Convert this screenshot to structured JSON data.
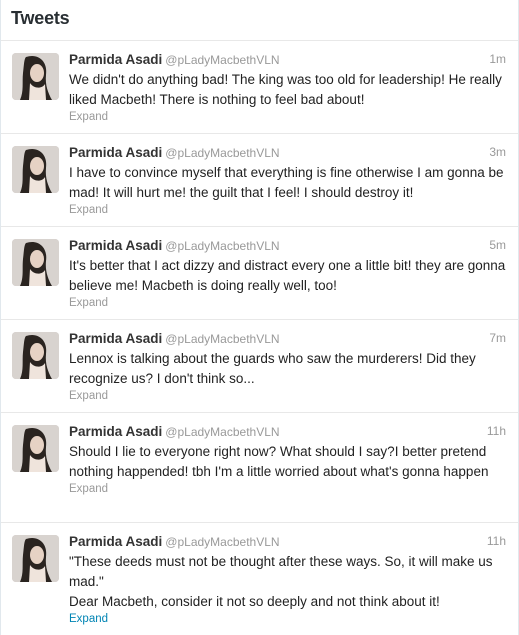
{
  "header": {
    "title": "Tweets"
  },
  "tweets": [
    {
      "name": "Parmida Asadi",
      "handle": "@pLadyMacbethVLN",
      "time": "1m",
      "text": "We didn't do anything bad! The king was too old for leadership! He really liked Macbeth! There is nothing to feel bad about!",
      "expand": "Expand"
    },
    {
      "name": "Parmida Asadi",
      "handle": "@pLadyMacbethVLN",
      "time": "3m",
      "text": "I have to convince myself that everything is fine otherwise I am gonna be mad! It will hurt me! the guilt that I feel! I should destroy it!",
      "expand": "Expand"
    },
    {
      "name": "Parmida Asadi",
      "handle": "@pLadyMacbethVLN",
      "time": "5m",
      "text": "It's better that I act dizzy and distract every one a little bit! they are gonna believe me! Macbeth is doing really well, too!",
      "expand": "Expand"
    },
    {
      "name": "Parmida Asadi",
      "handle": "@pLadyMacbethVLN",
      "time": "7m",
      "text": "Lennox is talking about the guards who saw the murderers! Did they recognize us? I don't think so...",
      "expand": "Expand"
    },
    {
      "name": "Parmida Asadi",
      "handle": "@pLadyMacbethVLN",
      "time": "11h",
      "text": "Should I lie to everyone right now? What should I say?I better pretend nothing happended! tbh I'm a little worried about what's gonna happen",
      "expand": "Expand"
    },
    {
      "name": "Parmida Asadi",
      "handle": "@pLadyMacbethVLN",
      "time": "11h",
      "text": "\"These deeds must not be thought after these ways. So, it will make us mad.\"",
      "text2": "Dear Macbeth, consider it not so deeply and not think about it!",
      "expand": "Expand"
    }
  ],
  "colors": {
    "link": "#0084b4",
    "muted": "#999999"
  },
  "icons": {
    "avatar": "profile-photo"
  }
}
